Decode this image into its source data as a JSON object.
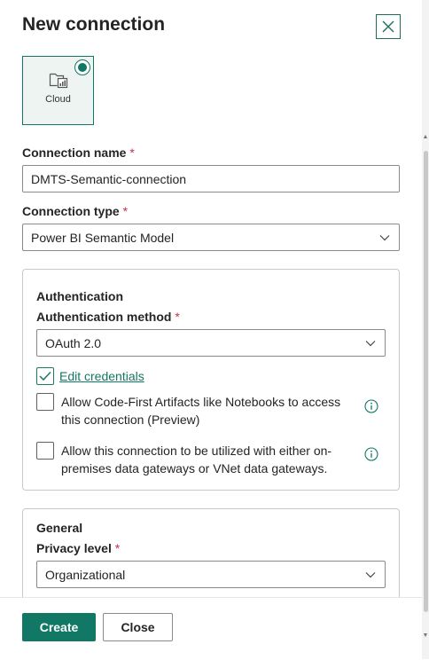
{
  "dialog": {
    "title": "New connection",
    "close_icon": "close-icon"
  },
  "connection_tile": {
    "label": "Cloud",
    "icon": "cloud-folder-icon",
    "selected": true
  },
  "connection_name": {
    "label": "Connection name",
    "required_mark": "*",
    "value": "DMTS-Semantic-connection"
  },
  "connection_type": {
    "label": "Connection type",
    "required_mark": "*",
    "value": "Power BI Semantic Model"
  },
  "authentication": {
    "section_title": "Authentication",
    "method_label": "Authentication method",
    "required_mark": "*",
    "method_value": "OAuth 2.0",
    "edit_credentials": {
      "label": "Edit credentials",
      "checked": true
    },
    "allow_code_first": {
      "line1": "Allow Code-First Artifacts like Notebooks to access",
      "line2": "this connection (Preview)",
      "checked": false
    },
    "allow_gateways": {
      "line1": "Allow this connection to be utilized with either on-",
      "line2": "premises data gateways or VNet data gateways.",
      "checked": false
    }
  },
  "general": {
    "section_title": "General",
    "privacy_label": "Privacy level",
    "required_mark": "*",
    "privacy_value": "Organizational"
  },
  "footer": {
    "create_label": "Create",
    "close_label": "Close"
  },
  "colors": {
    "accent": "#117865",
    "required": "#c4314b",
    "border": "#8a8a8a"
  }
}
